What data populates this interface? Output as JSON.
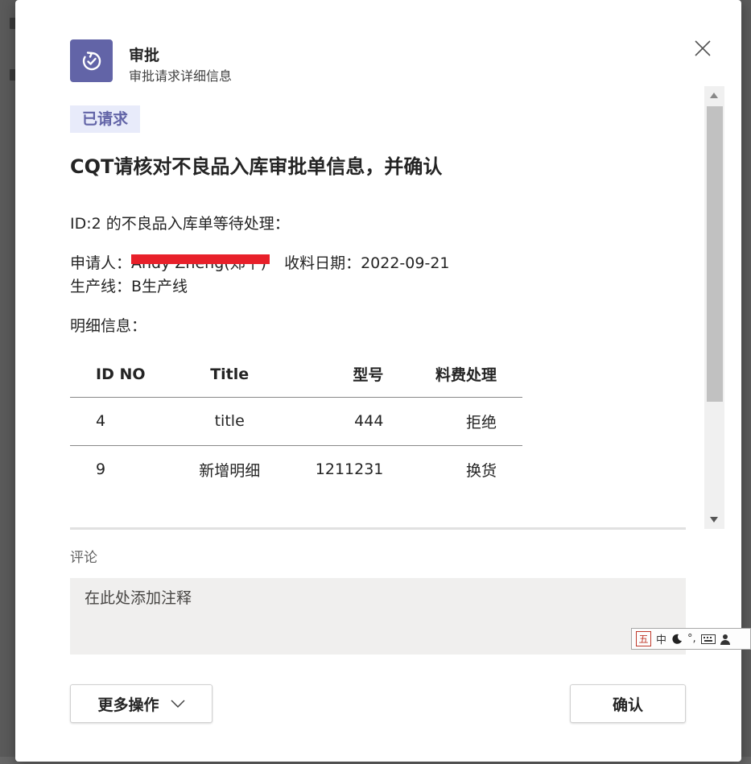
{
  "dialog": {
    "app_title": "审批",
    "app_subtitle": "审批请求详细信息",
    "accent_color": "#6264a7",
    "app_icon": "approvals-icon",
    "close_icon": "close-icon"
  },
  "request": {
    "status": "已请求",
    "title": "CQT请核对不良品入库审批单信息，并确认",
    "line_id": "ID:2 的不良品入库单等待处理：",
    "applicant_prefix": "申请人：",
    "applicant_name": "Andy Zheng(郑平)",
    "receive_date": "收料日期：2022-09-21",
    "production_line": "生产线：B生产线",
    "details_label": "明细信息："
  },
  "table": {
    "headers": [
      "ID NO",
      "Title",
      "型号",
      "料费处理"
    ],
    "rows": [
      [
        "4",
        "title",
        "444",
        "拒绝"
      ],
      [
        "9",
        "新增明细",
        "1211231",
        "换货"
      ]
    ]
  },
  "comment": {
    "label": "评论",
    "placeholder": "在此处添加注释"
  },
  "actions": {
    "more_label": "更多操作",
    "confirm_label": "确认"
  },
  "ime_toolbar": {
    "mode": "五",
    "lang": "中",
    "width_icon": "moon-icon",
    "punct": "°,",
    "keyboard_icon": "keyboard-icon",
    "user_icon": "user-icon"
  }
}
